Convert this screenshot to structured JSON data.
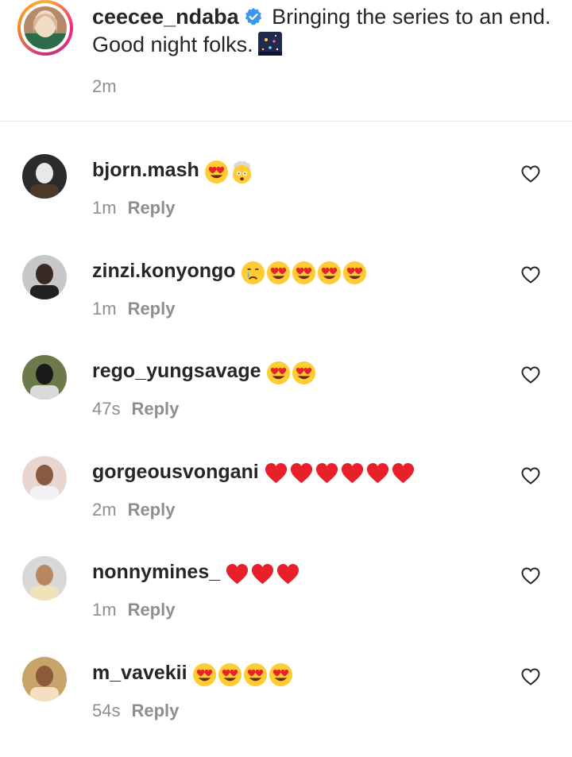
{
  "caption": {
    "username": "ceecee_ndaba",
    "text_line1": "Bringing the series to an end.",
    "text_line2": "Good night folks.",
    "time": "2m",
    "verified_icon": "verified-badge-icon",
    "emoji": "fireworks-icon"
  },
  "reply_label": "Reply",
  "colors": {
    "text": "#262626",
    "muted": "#8e8e8e",
    "verified": "#3897f0",
    "heart_red": "#e8202a",
    "emoji_yellow": "#ffcc33"
  },
  "comments": [
    {
      "username": "bjorn.mash",
      "emojis": [
        "heart-eyes",
        "exploding-head"
      ],
      "time": "1m"
    },
    {
      "username": "zinzi.konyongo",
      "emojis": [
        "crying-face",
        "heart-eyes",
        "heart-eyes",
        "heart-eyes",
        "heart-eyes"
      ],
      "time": "1m"
    },
    {
      "username": "rego_yungsavage",
      "emojis": [
        "heart-eyes",
        "heart-eyes"
      ],
      "time": "47s"
    },
    {
      "username": "gorgeousvongani",
      "emojis": [
        "red-heart",
        "red-heart",
        "red-heart",
        "red-heart",
        "red-heart",
        "red-heart"
      ],
      "time": "2m"
    },
    {
      "username": "nonnymines_",
      "emojis": [
        "red-heart",
        "red-heart",
        "red-heart"
      ],
      "time": "1m"
    },
    {
      "username": "m_vavekii",
      "emojis": [
        "heart-eyes",
        "heart-eyes",
        "heart-eyes",
        "heart-eyes"
      ],
      "time": "54s"
    }
  ]
}
